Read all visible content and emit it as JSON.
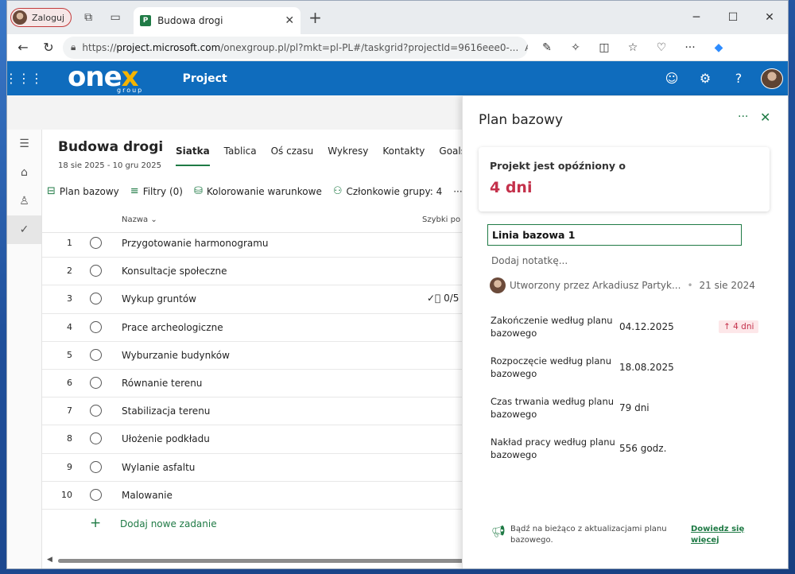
{
  "browser": {
    "profile_label": "Zaloguj",
    "tab_title": "Budowa drogi",
    "url_prefix": "https://",
    "url_domain": "project.microsoft.com",
    "url_rest": "/onexgroup.pl/pl?mkt=pl-PL#/taskgrid?projectId=9616eee0-..."
  },
  "app": {
    "logo_left": "one",
    "logo_x": "x",
    "logo_sub": "group",
    "name": "Project"
  },
  "project": {
    "title": "Budowa drogi",
    "dates": "18 sie 2025 - 10 gru 2025",
    "tabs": [
      "Siatka",
      "Tablica",
      "Oś czasu",
      "Wykresy",
      "Kontakty",
      "Goals"
    ],
    "tabs_more": "···"
  },
  "toolbar": {
    "baseline": "Plan bazowy",
    "filters": "Filtry (0)",
    "coloring": "Kolorowanie warunkowe",
    "members": "Członkowie grupy: 4",
    "more": "···"
  },
  "grid": {
    "col_name": "Nazwa",
    "col_quick": "Szybki po",
    "tasks": [
      {
        "num": "1",
        "name": "Przygotowanie harmonogramu",
        "check": ""
      },
      {
        "num": "2",
        "name": "Konsultacje społeczne",
        "check": ""
      },
      {
        "num": "3",
        "name": "Wykup gruntów",
        "check": "0/5"
      },
      {
        "num": "4",
        "name": "Prace archeologiczne",
        "check": ""
      },
      {
        "num": "5",
        "name": "Wyburzanie budynków",
        "check": ""
      },
      {
        "num": "6",
        "name": "Równanie terenu",
        "check": ""
      },
      {
        "num": "7",
        "name": "Stabilizacja terenu",
        "check": ""
      },
      {
        "num": "8",
        "name": "Ułożenie podkładu",
        "check": ""
      },
      {
        "num": "9",
        "name": "Wylanie asfaltu",
        "check": ""
      },
      {
        "num": "10",
        "name": "Malowanie",
        "check": ""
      }
    ],
    "add_task": "Dodaj nowe zadanie"
  },
  "panel": {
    "title": "Plan bazowy",
    "delay_label": "Projekt jest opóźniony o",
    "delay_value": "4 dni",
    "baseline_name": "Linia bazowa 1",
    "note_placeholder": "Dodaj notatkę...",
    "created_by": "Utworzony przez Arkadiusz Partyk...",
    "created_date": "21 sie 2024",
    "fields": [
      {
        "label": "Zakończenie według planu bazowego",
        "value": "04.12.2025",
        "badge": "↑ 4 dni"
      },
      {
        "label": "Rozpoczęcie według planu bazowego",
        "value": "18.08.2025",
        "badge": ""
      },
      {
        "label": "Czas trwania według planu bazowego",
        "value": "79 dni",
        "badge": ""
      },
      {
        "label": "Nakład pracy według planu bazowego",
        "value": "556 godz.",
        "badge": ""
      }
    ],
    "footer_text": "Bądź na bieżąco z aktualizacjami planu bazowego.",
    "footer_link": "Dowiedz się więcej"
  },
  "colors": {
    "accent": "#1f7a45",
    "brand": "#0f6cbd",
    "alert": "#c4314b"
  }
}
